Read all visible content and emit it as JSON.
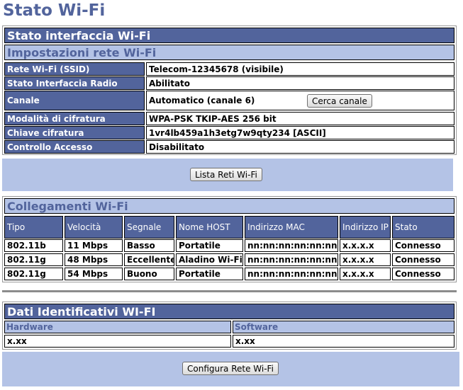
{
  "page_title": "Stato Wi-Fi",
  "interface": {
    "header": "Stato interfaccia Wi-Fi",
    "subheader": "Impostazioni rete Wi-Fi",
    "rows": [
      {
        "label": "Rete Wi-Fi (SSID)",
        "value": "Telecom-12345678 (visibile)"
      },
      {
        "label": "Stato Interfaccia Radio",
        "value": "Abilitato"
      },
      {
        "label": "Canale",
        "value": "Automatico (canale 6)"
      },
      {
        "label": "Modalità di cifratura",
        "value": "WPA-PSK TKIP-AES 256 bit"
      },
      {
        "label": "Chiave cifratura",
        "value": "1vr4lb459a1h3etg7w9qty234 [ASCII]"
      },
      {
        "label": "Controllo Accesso",
        "value": "Disabilitato"
      }
    ],
    "scan_button": "Cerca canale"
  },
  "list_button": "Lista Reti Wi-Fi",
  "connections": {
    "header": "Collegamenti Wi-Fi",
    "columns": [
      "Tipo",
      "Velocità",
      "Segnale",
      "Nome HOST",
      "Indirizzo MAC",
      "Indirizzo IP",
      "Stato"
    ],
    "rows": [
      [
        "802.11b",
        "11 Mbps",
        "Basso",
        "Portatile",
        "nn:nn:nn:nn:nn:nn",
        "x.x.x.x",
        "Connesso"
      ],
      [
        "802.11g",
        "48 Mbps",
        "Eccellente",
        "Aladino Wi-Fi",
        "nn:nn:nn:nn:nn:nn",
        "x.x.x.x",
        "Connesso"
      ],
      [
        "802.11g",
        "54 Mbps",
        "Buono",
        "Portatile",
        "nn:nn:nn:nn:nn:nn",
        "x.x.x.x",
        "Connesso"
      ]
    ]
  },
  "ident": {
    "header": "Dati Identificativi WI-FI",
    "hardware_label": "Hardware",
    "software_label": "Software",
    "hardware_value": "x.xx",
    "software_value": "x.xx"
  },
  "configure_button": "Configura Rete Wi-Fi"
}
